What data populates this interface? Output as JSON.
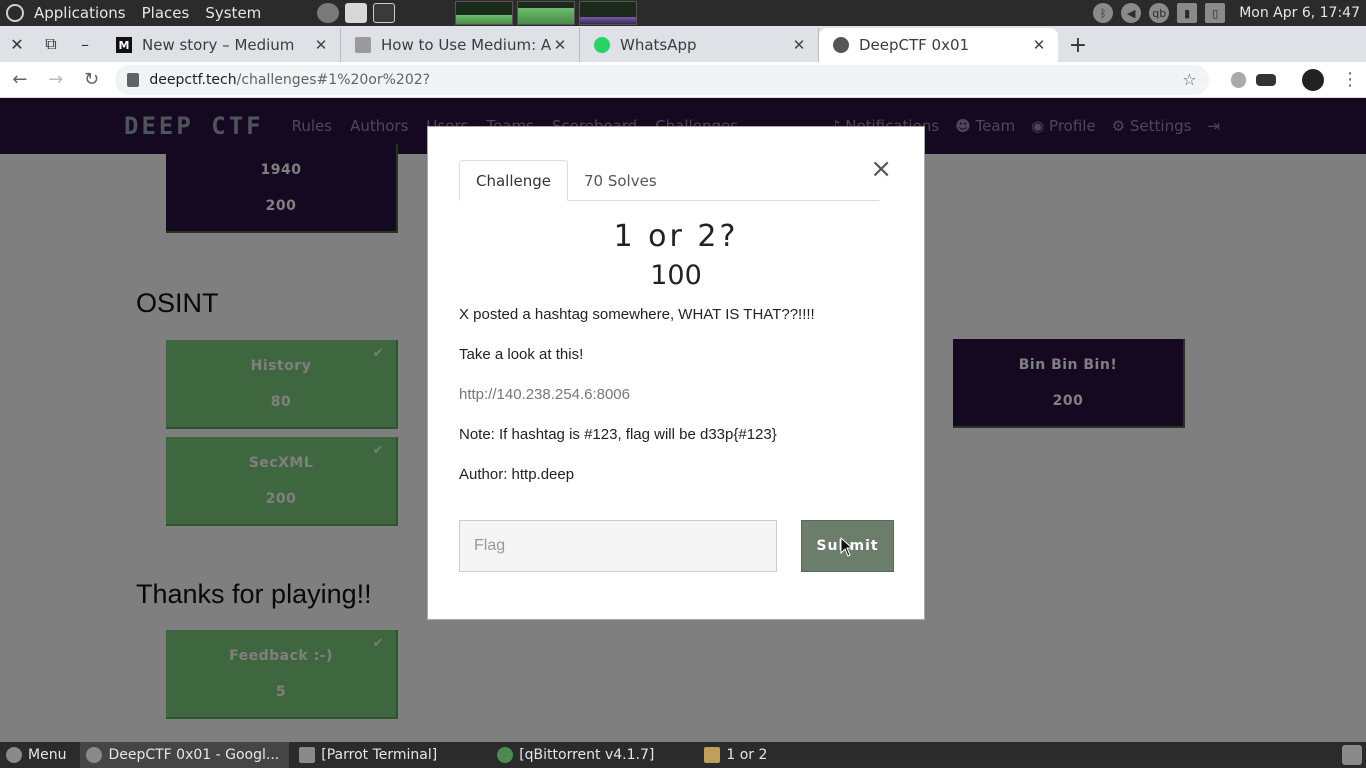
{
  "os_panel": {
    "menu_applications": "Applications",
    "menu_places": "Places",
    "menu_system": "System",
    "clock": "Mon Apr 6, 17:47",
    "tray_qb": "qb"
  },
  "browser": {
    "tabs": [
      {
        "title": "New story – Medium",
        "favicon": "M"
      },
      {
        "title": "How to Use Medium: A Beginner's Guide",
        "favicon": "doc"
      },
      {
        "title": "WhatsApp",
        "favicon": "whatsapp"
      },
      {
        "title": "DeepCTF 0x01",
        "favicon": "deepctf"
      }
    ],
    "url_host": "deepctf.tech",
    "url_path": "/challenges#1%20or%202?"
  },
  "site": {
    "brand": "DEEP CTF",
    "nav_links": [
      "Rules",
      "Authors",
      "Users",
      "Teams",
      "Scoreboard",
      "Challenges"
    ],
    "nav_right": [
      "Notifications",
      "Team",
      "Profile",
      "Settings"
    ],
    "sections": [
      {
        "title": "OSINT"
      },
      {
        "title": "Thanks for playing!!"
      }
    ],
    "cards": {
      "top": {
        "name": "1940",
        "value": "200"
      },
      "history": {
        "name": "History",
        "value": "80"
      },
      "secxml": {
        "name": "SecXML",
        "value": "200"
      },
      "binbin": {
        "name": "Bin Bin Bin!",
        "value": "200"
      },
      "feedback": {
        "name": "Feedback :-)",
        "value": "5"
      }
    }
  },
  "modal": {
    "tab_challenge": "Challenge",
    "tab_solves": "70 Solves",
    "challenge_name": "1 or 2?",
    "challenge_value": "100",
    "desc_1": "X posted a hashtag somewhere, WHAT IS THAT??!!!!",
    "desc_2": "Take a look at this!",
    "desc_link": "http://140.238.254.6:8006",
    "desc_3": "Note: If hashtag is #123, flag will be d33p{#123}",
    "desc_4": "Author: http.deep",
    "flag_placeholder": "Flag",
    "submit_label": "Submit",
    "close_symbol": "×"
  },
  "taskbar": {
    "menu": "Menu",
    "items": [
      {
        "label": "DeepCTF 0x01 - Googl..."
      },
      {
        "label": "[Parrot Terminal]"
      },
      {
        "label": "[qBittorrent v4.1.7]"
      },
      {
        "label": "1 or 2"
      }
    ]
  }
}
